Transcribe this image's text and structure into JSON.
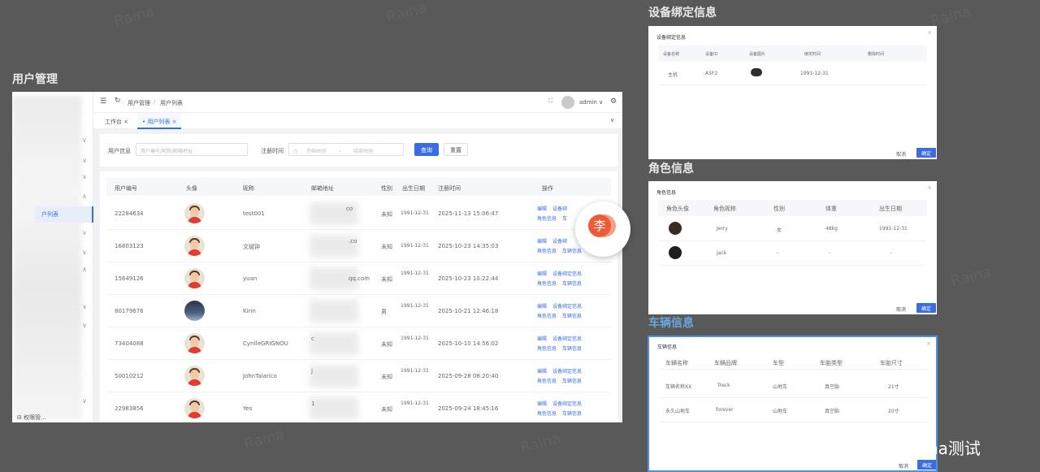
{
  "watermark": "Raina",
  "section_titles": {
    "user_mgmt": "用户管理",
    "device": "设备绑定信息",
    "role": "角色信息",
    "vehicle": "车辆信息"
  },
  "main": {
    "sidebar": {
      "active_item": "户列表",
      "bottom_item": "权限管..."
    },
    "topbar": {
      "breadcrumb": [
        "用户管理",
        "用户列表"
      ],
      "breadcrumb_sep": "/",
      "username": "admin",
      "menu_icon": "☰",
      "refresh_icon": "↻",
      "fullscreen_icon": "⛶",
      "gear_icon": "⚙",
      "caret": "∨"
    },
    "tabs": [
      {
        "label": "工作台 ×"
      },
      {
        "label": "• 用户列表 ×"
      }
    ],
    "tabs_caret": "∨",
    "search": {
      "user_label": "用户信息",
      "user_placeholder": "用户编号/昵称/邮箱地址",
      "time_label": "注册时间",
      "start_placeholder": "开始时间",
      "range_sep": "-",
      "end_placeholder": "结束时间",
      "query_button": "查询",
      "reset_button": "重置"
    },
    "table": {
      "headers": [
        "用户编号",
        "头像",
        "昵称",
        "邮箱地址",
        "性别",
        "出生日期",
        "注册时间",
        "操作"
      ],
      "rows": [
        {
          "id": "22284634",
          "nick": "test001",
          "email": "co",
          "gender": "未知",
          "birth": "1991-12-31",
          "reg": "2025-11-13 15:06:47",
          "op1": "编辑",
          "op2": "设备绑",
          "op3": "角色信息",
          "op4": "车"
        },
        {
          "id": "16803123",
          "nick": "文斌钟",
          "email": ".co",
          "gender": "未知",
          "birth": "1991-12-31",
          "reg": "2025-10-23 14:35:03",
          "op1": "编辑",
          "op2": "设备绑",
          "op3": "角色信息",
          "op4": "车辆信息"
        },
        {
          "id": "15649126",
          "nick": "yuan",
          "email": "qq.com",
          "gender": "未知",
          "birth": "1991-12-31",
          "reg": "2025-10-23 10:22:44",
          "op1": "编辑",
          "op2": "设备绑定信息",
          "op3": "角色信息",
          "op4": "车辆信息"
        },
        {
          "id": "80179676",
          "nick": "Kirin",
          "email": "",
          "gender": "男",
          "birth": "1991-12-31",
          "reg": "2025-10-21 12:46:18",
          "op1": "编辑",
          "op2": "设备绑定信息",
          "op3": "角色信息",
          "op4": "车辆信息"
        },
        {
          "id": "73404088",
          "nick": "CyrilleGRIGNOU",
          "email": "c",
          "gender": "未知",
          "birth": "1991-12-31",
          "reg": "2025-10-10 14:56:02",
          "op1": "编辑",
          "op2": "设备绑定信息",
          "op3": "角色信息",
          "op4": "车辆信息"
        },
        {
          "id": "50010212",
          "nick": "JohnTalarico",
          "email": "j",
          "gender": "未知",
          "birth": "1991-12-31",
          "reg": "2025-09-28 08:20:40",
          "op1": "编辑",
          "op2": "设备绑定信息",
          "op3": "角色信息",
          "op4": "车辆信息"
        },
        {
          "id": "22983856",
          "nick": "Yes",
          "email": "1",
          "gender": "未知",
          "birth": "1991-12-31",
          "reg": "2025-09-24 18:45:16",
          "op1": "编辑",
          "op2": "设备绑定信息",
          "op3": "角色信息",
          "op4": "车辆信息"
        }
      ]
    },
    "float_badge": "李"
  },
  "device_dialog": {
    "title": "设备绑定信息",
    "headers": [
      "设备名称",
      "设备ID",
      "设备图片",
      "绑定时间",
      "删除时间"
    ],
    "row": {
      "name": "主机",
      "id": "A5F2",
      "bind": "1991-12-31"
    },
    "cancel": "取消",
    "ok": "确定"
  },
  "role_dialog": {
    "title": "角色信息",
    "headers": [
      "角色头像",
      "角色昵称",
      "性别",
      "体重",
      "出生日期"
    ],
    "rows": [
      {
        "nick": "Jerry",
        "gender": "女",
        "weight": "48kg",
        "birth": "1991-12-31"
      },
      {
        "nick": "Jack",
        "gender": "-",
        "weight": "-",
        "birth": "-"
      }
    ],
    "cancel": "取消",
    "ok": "确定"
  },
  "vehicle_dialog": {
    "title": "车辆信息",
    "headers": [
      "车辆名称",
      "车辆品牌",
      "车型",
      "车胎类型",
      "车胎尺寸"
    ],
    "rows": [
      {
        "name": "车辆名称XX",
        "brand": "Treck",
        "type": "山地车",
        "tire": "真空胎",
        "size": "21寸"
      },
      {
        "name": "永久山地车",
        "brand": "forever",
        "type": "山地车",
        "tire": "真空胎",
        "size": "20寸"
      }
    ],
    "cancel": "取消",
    "ok": "确定"
  },
  "close_glyph": "×",
  "footer": "掘金技术社区 @ Raina测试"
}
